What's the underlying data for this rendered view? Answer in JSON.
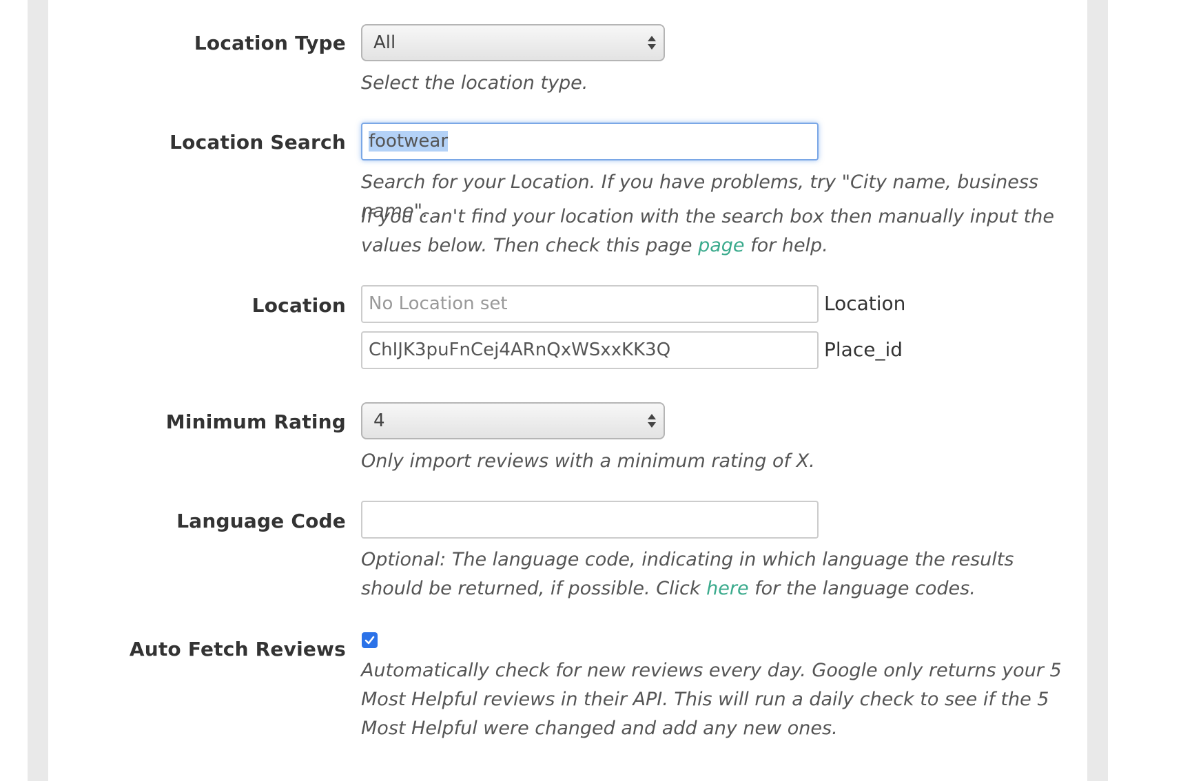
{
  "location_type": {
    "label": "Location Type",
    "selected": "All",
    "help": "Select the location type."
  },
  "location_search": {
    "label": "Location Search",
    "value": "footwear",
    "help": "Search for your Location. If you have problems, try \"City name, business name\".",
    "manual_help_before": "If you can't find your location with the search box then manually input the values below. Then check this page ",
    "manual_help_link": "page",
    "manual_help_after": " for help."
  },
  "location": {
    "label": "Location",
    "location_placeholder": "No Location set",
    "location_suffix": "Location",
    "place_id_value": "ChIJK3puFnCej4ARnQxWSxxKK3Q",
    "place_id_suffix": "Place_id"
  },
  "minimum_rating": {
    "label": "Minimum Rating",
    "selected": "4",
    "help": "Only import reviews with a minimum rating of X."
  },
  "language_code": {
    "label": "Language Code",
    "value": "",
    "help_before": "Optional: The language code, indicating in which language the results should be returned, if possible. Click ",
    "help_link": "here",
    "help_after": " for the language codes."
  },
  "auto_fetch": {
    "label": "Auto Fetch Reviews",
    "checked": true,
    "help": "Automatically check for new reviews every day. Google only returns your 5 Most Helpful reviews in their API. This will run a daily check to see if the 5 Most Helpful were changed and add any new ones."
  },
  "colors": {
    "link": "#3aaa8c",
    "checkbox": "#2b72e8",
    "focus_ring": "#7aa7e6",
    "gutter": "#e9e9e9"
  }
}
